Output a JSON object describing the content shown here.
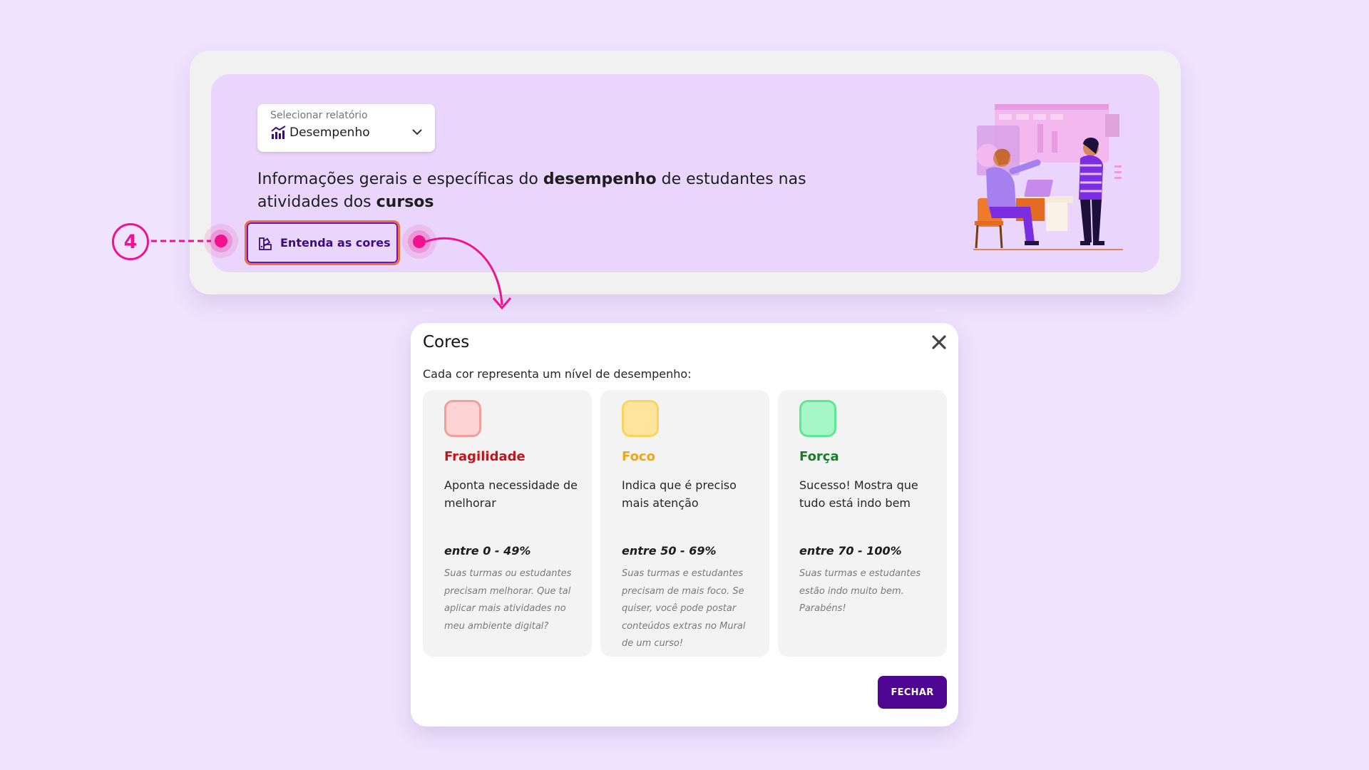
{
  "report_selector": {
    "label": "Selecionar relatório",
    "value": "Desempenho",
    "icon": "bar-chart-icon"
  },
  "headline": {
    "part1": "Informações gerais e específicas do ",
    "bold1": "desempenho",
    "part2": " de estudantes nas atividades dos ",
    "bold2": "cursos"
  },
  "colors_button": {
    "label": "Entenda as cores",
    "icon": "palette-icon"
  },
  "annotation": {
    "step": "4",
    "color": "#f2118e"
  },
  "modal": {
    "title": "Cores",
    "subtitle": "Cada cor representa um nível de desempenho:",
    "close_icon": "close-icon",
    "levels": [
      {
        "name": "Fragilidade",
        "description": "Aponta necessidade de melhorar",
        "range": "entre 0 - 49%",
        "note": "Suas turmas ou estudantes precisam melhorar. Que tal aplicar mais atividades no meu ambiente digital?",
        "name_color": "#c2141c",
        "swatch_fill": "#fdd4d3",
        "swatch_border": "#f49e9c"
      },
      {
        "name": "Foco",
        "description": "Indica que é preciso mais atenção",
        "range": "entre 50 - 69%",
        "note": "Suas turmas e estudantes precisam de mais foco. Se quiser, você pode postar conteúdos extras no Mural de um curso!",
        "name_color": "#f2a516",
        "swatch_fill": "#ffe49c",
        "swatch_border": "#fcd45c"
      },
      {
        "name": "Força",
        "description": "Sucesso! Mostra que tudo está indo bem",
        "range": "entre 70 - 100%",
        "note": "Suas turmas e estudantes estão indo muito bem. Parabéns!",
        "name_color": "#1b7d2a",
        "swatch_fill": "#a6f6c8",
        "swatch_border": "#5ee88f"
      }
    ],
    "close_button": "FECHAR"
  },
  "colors": {
    "page_bg": "#f0e3fe",
    "accent_purple": "#4e0592",
    "button_border": "#f06e3f"
  }
}
